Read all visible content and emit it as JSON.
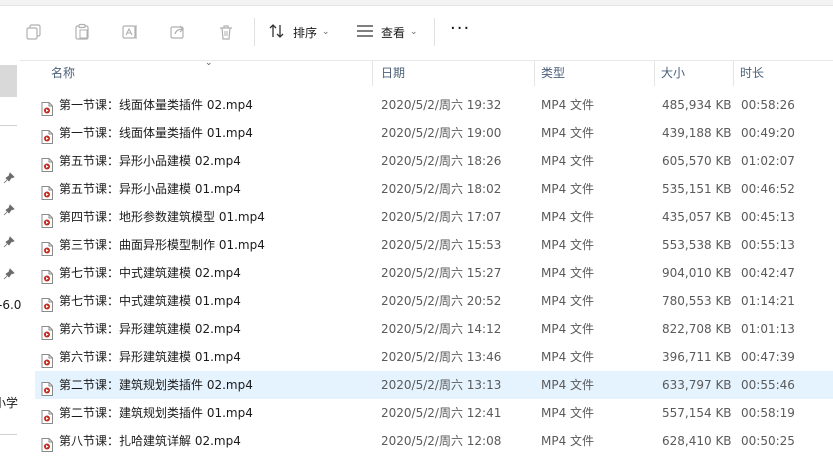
{
  "toolbar": {
    "sort_label": "排序",
    "view_label": "查看",
    "more_label": "···"
  },
  "nav": {
    "fragment_1": "-6.0",
    "fragment_2": "小学"
  },
  "columns": {
    "name": "名称",
    "date": "日期",
    "type": "类型",
    "size": "大小",
    "duration": "时长"
  },
  "files": [
    {
      "name": "第一节课：线面体量类插件 02.mp4",
      "date": "2020/5/2/周六 19:32",
      "type": "MP4 文件",
      "size": "485,934 KB",
      "duration": "00:58:26"
    },
    {
      "name": "第一节课：线面体量类插件 01.mp4",
      "date": "2020/5/2/周六 19:00",
      "type": "MP4 文件",
      "size": "439,188 KB",
      "duration": "00:49:20"
    },
    {
      "name": "第五节课：异形小品建模 02.mp4",
      "date": "2020/5/2/周六 18:26",
      "type": "MP4 文件",
      "size": "605,570 KB",
      "duration": "01:02:07"
    },
    {
      "name": "第五节课：异形小品建模 01.mp4",
      "date": "2020/5/2/周六 18:02",
      "type": "MP4 文件",
      "size": "535,151 KB",
      "duration": "00:46:52"
    },
    {
      "name": "第四节课：地形参数建筑模型 01.mp4",
      "date": "2020/5/2/周六 17:07",
      "type": "MP4 文件",
      "size": "435,057 KB",
      "duration": "00:45:13"
    },
    {
      "name": "第三节课：曲面异形模型制作 01.mp4",
      "date": "2020/5/2/周六 15:53",
      "type": "MP4 文件",
      "size": "553,538 KB",
      "duration": "00:55:13"
    },
    {
      "name": "第七节课：中式建筑建模 02.mp4",
      "date": "2020/5/2/周六 15:27",
      "type": "MP4 文件",
      "size": "904,010 KB",
      "duration": "00:42:47"
    },
    {
      "name": "第七节课：中式建筑建模 01.mp4",
      "date": "2020/5/2/周六 20:52",
      "type": "MP4 文件",
      "size": "780,553 KB",
      "duration": "01:14:21"
    },
    {
      "name": "第六节课：异形建筑建模 02.mp4",
      "date": "2020/5/2/周六 14:12",
      "type": "MP4 文件",
      "size": "822,708 KB",
      "duration": "01:01:13"
    },
    {
      "name": "第六节课：异形建筑建模 01.mp4",
      "date": "2020/5/2/周六 13:46",
      "type": "MP4 文件",
      "size": "396,711 KB",
      "duration": "00:47:39"
    },
    {
      "name": "第二节课：建筑规划类插件 02.mp4",
      "date": "2020/5/2/周六 13:13",
      "type": "MP4 文件",
      "size": "633,797 KB",
      "duration": "00:55:46"
    },
    {
      "name": "第二节课：建筑规划类插件 01.mp4",
      "date": "2020/5/2/周六 12:41",
      "type": "MP4 文件",
      "size": "557,154 KB",
      "duration": "00:58:19"
    },
    {
      "name": "第八节课：扎哈建筑详解 02.mp4",
      "date": "2020/5/2/周六 12:08",
      "type": "MP4 文件",
      "size": "628,410 KB",
      "duration": "00:50:25"
    }
  ],
  "selected_file_index": 10,
  "colors": {
    "selection": "#e5f3ff",
    "header_text": "#4c607a",
    "file_icon_accent": "#c42b1c"
  }
}
